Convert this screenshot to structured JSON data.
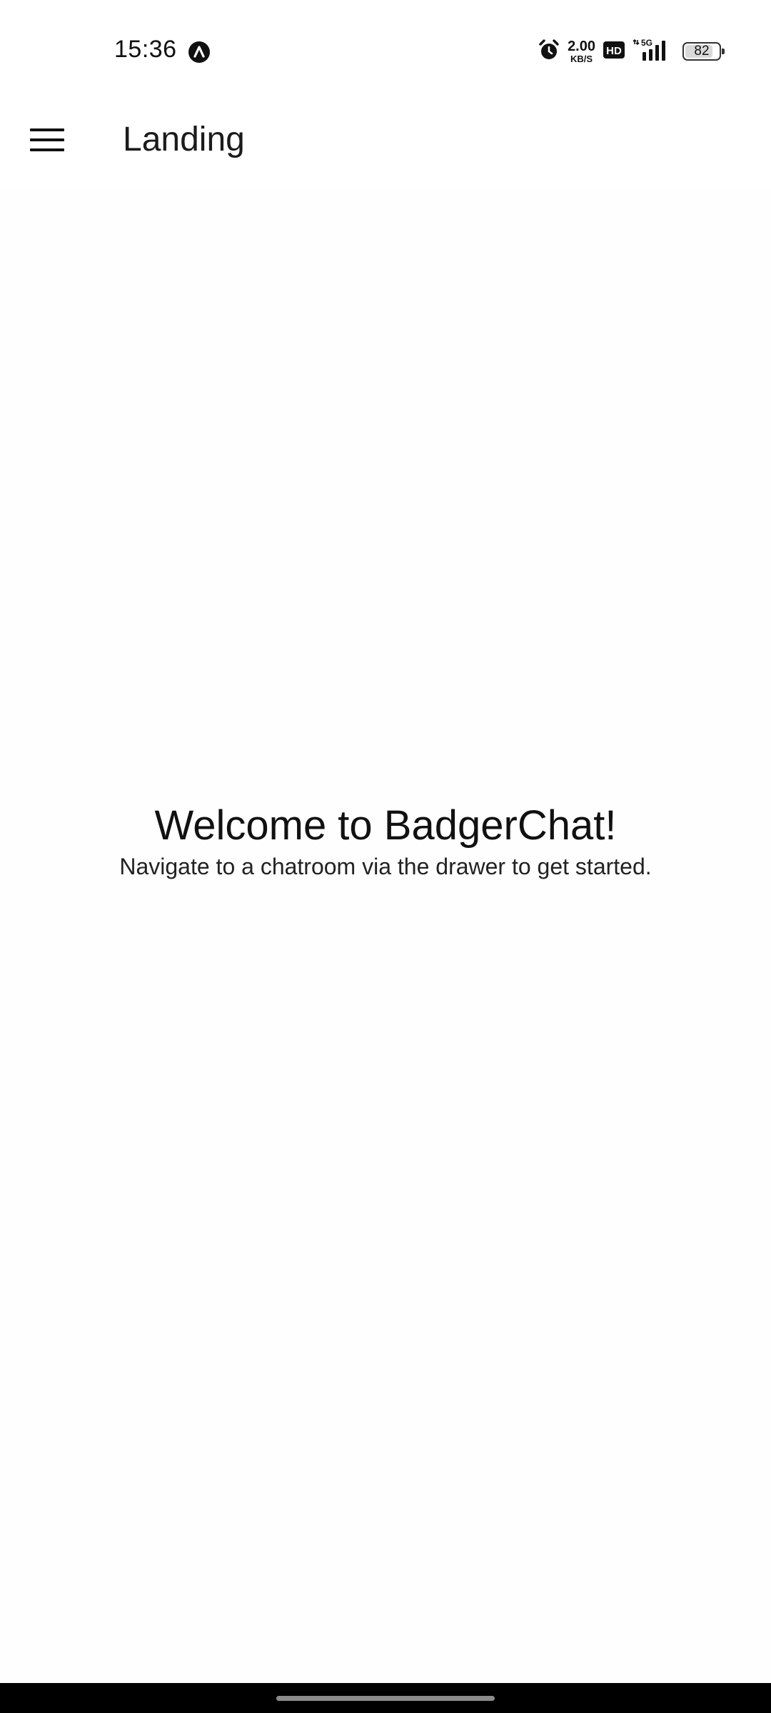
{
  "status_bar": {
    "time": "15:36",
    "app_icon": "navigation-arrow-icon",
    "alarm_icon": "alarm-icon",
    "net_speed_value": "2.00",
    "net_speed_unit": "KB/S",
    "hd_label": "HD",
    "signal_label": "5G",
    "battery_level": "82",
    "battery_fraction": 0.82
  },
  "app_bar": {
    "menu_icon": "hamburger-menu-icon",
    "title": "Landing"
  },
  "main": {
    "welcome_title": "Welcome to BadgerChat!",
    "welcome_subtitle": "Navigate to a chatroom via the drawer to get started."
  },
  "colors": {
    "background": "#ffffff",
    "text": "#111111",
    "nav_bar": "#000000"
  }
}
